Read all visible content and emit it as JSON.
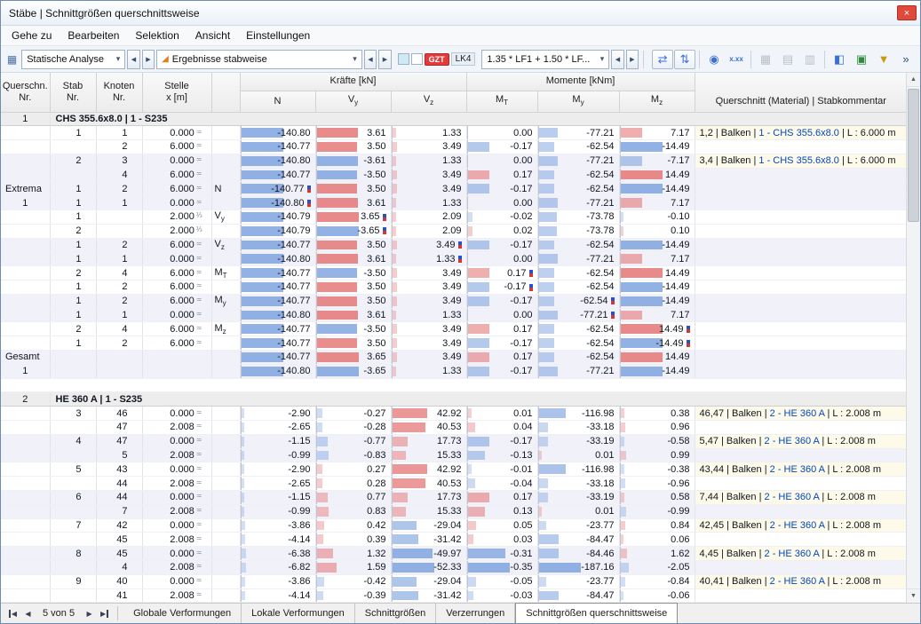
{
  "colors": {
    "accent_red": "#e03c3c",
    "bar_negative": "#7aa0de",
    "bar_positive": "#e47070",
    "link_blue": "#0046c8"
  },
  "glyphs": {
    "close": "×",
    "left": "◀",
    "right": "▶",
    "up": "▲",
    "down": "▼",
    "down_small": "▾"
  },
  "window": {
    "title": "Stäbe | Schnittgrößen querschnittsweise"
  },
  "menu": {
    "items": [
      "Gehe zu",
      "Bearbeiten",
      "Selektion",
      "Ansicht",
      "Einstellungen"
    ]
  },
  "toolbar": {
    "analysis": {
      "icon": "▦",
      "label": "Statische Analyse"
    },
    "results": {
      "icon": "◢",
      "label": "Ergebnisse stabweise"
    },
    "badges": {
      "gzt": "GZT",
      "lk": "LK4"
    },
    "combo": {
      "label": "1.35 * LF1 + 1.50 * LF..."
    },
    "icons": [
      {
        "name": "show-result-values-icon",
        "glyph": "⇄",
        "color": "#3a6fd8",
        "framed": true
      },
      {
        "name": "show-result-diagrams-icon",
        "glyph": "⇅",
        "color": "#3a6fd8",
        "framed": true
      },
      {
        "sep": true
      },
      {
        "name": "search-value-icon",
        "glyph": "◉",
        "color": "#3a6fd8"
      },
      {
        "name": "decimal-places-icon",
        "glyph": "x.xx",
        "color": "#3a6fd8",
        "text": true
      },
      {
        "sep": true
      },
      {
        "name": "table-view-icon",
        "glyph": "▦",
        "color": "#8a949e",
        "disabled": true
      },
      {
        "name": "print-table-icon",
        "glyph": "▤",
        "color": "#8a949e",
        "disabled": true
      },
      {
        "name": "export-table-icon",
        "glyph": "▥",
        "color": "#8a949e",
        "disabled": true
      },
      {
        "sep": true
      },
      {
        "name": "result-table-settings-icon",
        "glyph": "◧",
        "color": "#3a6fd8"
      },
      {
        "name": "printout-report-icon",
        "glyph": "▣",
        "color": "#2e8b3a"
      },
      {
        "name": "filter-results-icon",
        "glyph": "▼",
        "color": "#c99a10"
      },
      {
        "name": "toolbar-overflow-icon",
        "glyph": "»",
        "color": "#2a4a80"
      }
    ]
  },
  "table": {
    "headers": {
      "qn_l1": "Querschn.",
      "qn_l2": "Nr.",
      "stab_l1": "Stab",
      "stab_l2": "Nr.",
      "knoten_l1": "Knoten",
      "knoten_l2": "Nr.",
      "stelle_l1": "Stelle",
      "stelle_l2": "x [m]",
      "forces_group": "Kräfte [kN]",
      "moments_group": "Momente [kNm]",
      "comment": "Querschnitt (Material) | Stabkommentar",
      "n": "N",
      "vy_m": "V",
      "vy_s": "y",
      "vz_m": "V",
      "vz_s": "z",
      "mt_m": "M",
      "mt_s": "T",
      "my_m": "M",
      "my_s": "y",
      "mz_m": "M",
      "mz_s": "z"
    },
    "rows": [
      {
        "t": "g",
        "qn": "1",
        "label": "CHS 355.6x8.0 | 1 - S235"
      },
      {
        "t": "d",
        "b": 0,
        "stab": "1",
        "kn": "1",
        "x": "0.000",
        "sym": "≍",
        "v": [
          -140.8,
          3.61,
          1.33,
          0.0,
          -77.21,
          7.17
        ],
        "cm": {
          "pre": "1,2 | Balken | ",
          "link": "1 - CHS 355.6x8.0",
          "post": " | L : 6.000 m"
        }
      },
      {
        "t": "d",
        "b": 0,
        "kn": "2",
        "x": "6.000",
        "sym": "≍",
        "v": [
          -140.77,
          3.5,
          3.49,
          -0.17,
          -62.54,
          -14.49
        ]
      },
      {
        "t": "d",
        "b": 1,
        "stab": "2",
        "kn": "3",
        "x": "0.000",
        "sym": "≍",
        "v": [
          -140.8,
          -3.61,
          1.33,
          0.0,
          -77.21,
          -7.17
        ],
        "cm": {
          "pre": "3,4 | Balken | ",
          "link": "1 - CHS 355.6x8.0",
          "post": " | L : 6.000 m"
        }
      },
      {
        "t": "d",
        "b": 1,
        "kn": "4",
        "x": "6.000",
        "sym": "≍",
        "v": [
          -140.77,
          -3.5,
          3.49,
          0.17,
          -62.54,
          14.49
        ]
      },
      {
        "t": "d",
        "b": 1,
        "qn": "Extrema",
        "stab": "1",
        "kn": "2",
        "x": "6.000",
        "sym": "≍",
        "ex": "N",
        "v": [
          -140.77,
          3.5,
          3.49,
          -0.17,
          -62.54,
          -14.49
        ],
        "mk": 0
      },
      {
        "t": "d",
        "b": 1,
        "qn": "1",
        "stab": "1",
        "kn": "1",
        "x": "0.000",
        "sym": "≍",
        "v": [
          -140.8,
          3.61,
          1.33,
          0.0,
          -77.21,
          7.17
        ],
        "mk": 0
      },
      {
        "t": "d",
        "b": 0,
        "stab": "1",
        "x": "2.000",
        "sym": "⅓",
        "ex": "V_y",
        "v": [
          -140.79,
          3.65,
          2.09,
          -0.02,
          -73.78,
          -0.1
        ],
        "mk": 1
      },
      {
        "t": "d",
        "b": 0,
        "stab": "2",
        "x": "2.000",
        "sym": "⅓",
        "v": [
          -140.79,
          -3.65,
          2.09,
          0.02,
          -73.78,
          0.1
        ],
        "mk": 1
      },
      {
        "t": "d",
        "b": 1,
        "stab": "1",
        "kn": "2",
        "x": "6.000",
        "sym": "≍",
        "ex": "V_z",
        "v": [
          -140.77,
          3.5,
          3.49,
          -0.17,
          -62.54,
          -14.49
        ],
        "mk": 2
      },
      {
        "t": "d",
        "b": 1,
        "stab": "1",
        "kn": "1",
        "x": "0.000",
        "sym": "≍",
        "v": [
          -140.8,
          3.61,
          1.33,
          0.0,
          -77.21,
          7.17
        ],
        "mk": 2
      },
      {
        "t": "d",
        "b": 0,
        "stab": "2",
        "kn": "4",
        "x": "6.000",
        "sym": "≍",
        "ex": "M_T",
        "v": [
          -140.77,
          -3.5,
          3.49,
          0.17,
          -62.54,
          14.49
        ],
        "mk": 3
      },
      {
        "t": "d",
        "b": 0,
        "stab": "1",
        "kn": "2",
        "x": "6.000",
        "sym": "≍",
        "v": [
          -140.77,
          3.5,
          3.49,
          -0.17,
          -62.54,
          -14.49
        ],
        "mk": 3
      },
      {
        "t": "d",
        "b": 1,
        "stab": "1",
        "kn": "2",
        "x": "6.000",
        "sym": "≍",
        "ex": "M_y",
        "v": [
          -140.77,
          3.5,
          3.49,
          -0.17,
          -62.54,
          -14.49
        ],
        "mk": 4
      },
      {
        "t": "d",
        "b": 1,
        "stab": "1",
        "kn": "1",
        "x": "0.000",
        "sym": "≍",
        "v": [
          -140.8,
          3.61,
          1.33,
          0.0,
          -77.21,
          7.17
        ],
        "mk": 4
      },
      {
        "t": "d",
        "b": 0,
        "stab": "2",
        "kn": "4",
        "x": "6.000",
        "sym": "≍",
        "ex": "M_z",
        "v": [
          -140.77,
          -3.5,
          3.49,
          0.17,
          -62.54,
          14.49
        ],
        "mk": 5
      },
      {
        "t": "d",
        "b": 0,
        "stab": "1",
        "kn": "2",
        "x": "6.000",
        "sym": "≍",
        "v": [
          -140.77,
          3.5,
          3.49,
          -0.17,
          -62.54,
          -14.49
        ],
        "mk": 5
      },
      {
        "t": "d",
        "b": 1,
        "qn": "Gesamt",
        "v": [
          -140.77,
          3.65,
          3.49,
          0.17,
          -62.54,
          14.49
        ]
      },
      {
        "t": "d",
        "b": 1,
        "qn": "1",
        "v": [
          -140.8,
          -3.65,
          1.33,
          -0.17,
          -77.21,
          -14.49
        ]
      },
      {
        "t": "s"
      },
      {
        "t": "g",
        "qn": "2",
        "label": "HE 360 A | 1 - S235"
      },
      {
        "t": "d",
        "b": 0,
        "stab": "3",
        "kn": "46",
        "x": "0.000",
        "sym": "≍",
        "v": [
          -2.9,
          -0.27,
          42.92,
          0.01,
          -116.98,
          0.38
        ],
        "cm": {
          "pre": "46,47 | Balken | ",
          "link": "2 - HE 360 A",
          "post": " | L : 2.008 m"
        }
      },
      {
        "t": "d",
        "b": 0,
        "kn": "47",
        "x": "2.008",
        "sym": "≍",
        "v": [
          -2.65,
          -0.28,
          40.53,
          0.04,
          -33.18,
          0.96
        ]
      },
      {
        "t": "d",
        "b": 1,
        "stab": "4",
        "kn": "47",
        "x": "0.000",
        "sym": "≍",
        "v": [
          -1.15,
          -0.77,
          17.73,
          -0.17,
          -33.19,
          -0.58
        ],
        "cm": {
          "pre": "5,47 | Balken | ",
          "link": "2 - HE 360 A",
          "post": " | L : 2.008 m"
        }
      },
      {
        "t": "d",
        "b": 1,
        "kn": "5",
        "x": "2.008",
        "sym": "≍",
        "v": [
          -0.99,
          -0.83,
          15.33,
          -0.13,
          0.01,
          0.99
        ]
      },
      {
        "t": "d",
        "b": 0,
        "stab": "5",
        "kn": "43",
        "x": "0.000",
        "sym": "≍",
        "v": [
          -2.9,
          0.27,
          42.92,
          -0.01,
          -116.98,
          -0.38
        ],
        "cm": {
          "pre": "43,44 | Balken | ",
          "link": "2 - HE 360 A",
          "post": " | L : 2.008 m"
        }
      },
      {
        "t": "d",
        "b": 0,
        "kn": "44",
        "x": "2.008",
        "sym": "≍",
        "v": [
          -2.65,
          0.28,
          40.53,
          -0.04,
          -33.18,
          -0.96
        ]
      },
      {
        "t": "d",
        "b": 1,
        "stab": "6",
        "kn": "44",
        "x": "0.000",
        "sym": "≍",
        "v": [
          -1.15,
          0.77,
          17.73,
          0.17,
          -33.19,
          0.58
        ],
        "cm": {
          "pre": "7,44 | Balken | ",
          "link": "2 - HE 360 A",
          "post": " | L : 2.008 m"
        }
      },
      {
        "t": "d",
        "b": 1,
        "kn": "7",
        "x": "2.008",
        "sym": "≍",
        "v": [
          -0.99,
          0.83,
          15.33,
          0.13,
          0.01,
          -0.99
        ]
      },
      {
        "t": "d",
        "b": 0,
        "stab": "7",
        "kn": "42",
        "x": "0.000",
        "sym": "≍",
        "v": [
          -3.86,
          0.42,
          -29.04,
          0.05,
          -23.77,
          0.84
        ],
        "cm": {
          "pre": "42,45 | Balken | ",
          "link": "2 - HE 360 A",
          "post": " | L : 2.008 m"
        }
      },
      {
        "t": "d",
        "b": 0,
        "kn": "45",
        "x": "2.008",
        "sym": "≍",
        "v": [
          -4.14,
          0.39,
          -31.42,
          0.03,
          -84.47,
          0.06
        ]
      },
      {
        "t": "d",
        "b": 1,
        "stab": "8",
        "kn": "45",
        "x": "0.000",
        "sym": "≍",
        "v": [
          -6.38,
          1.32,
          -49.97,
          -0.31,
          -84.46,
          1.62
        ],
        "cm": {
          "pre": "4,45 | Balken | ",
          "link": "2 - HE 360 A",
          "post": " | L : 2.008 m"
        }
      },
      {
        "t": "d",
        "b": 1,
        "kn": "4",
        "x": "2.008",
        "sym": "≍",
        "v": [
          -6.82,
          1.59,
          -52.33,
          -0.35,
          -187.16,
          -2.05
        ]
      },
      {
        "t": "d",
        "b": 0,
        "stab": "9",
        "kn": "40",
        "x": "0.000",
        "sym": "≍",
        "v": [
          -3.86,
          -0.42,
          -29.04,
          -0.05,
          -23.77,
          -0.84
        ],
        "cm": {
          "pre": "40,41 | Balken | ",
          "link": "2 - HE 360 A",
          "post": " | L : 2.008 m"
        }
      },
      {
        "t": "d",
        "b": 0,
        "kn": "41",
        "x": "2.008",
        "sym": "≍",
        "v": [
          -4.14,
          -0.39,
          -31.42,
          -0.03,
          -84.47,
          -0.06
        ]
      }
    ]
  },
  "footer": {
    "page": "5 von 5",
    "tabs": [
      {
        "label": "Globale Verformungen",
        "active": false
      },
      {
        "label": "Lokale Verformungen",
        "active": false
      },
      {
        "label": "Schnittgrößen",
        "active": false
      },
      {
        "label": "Verzerrungen",
        "active": false
      },
      {
        "label": "Schnittgrößen querschnittsweise",
        "active": true
      }
    ]
  }
}
